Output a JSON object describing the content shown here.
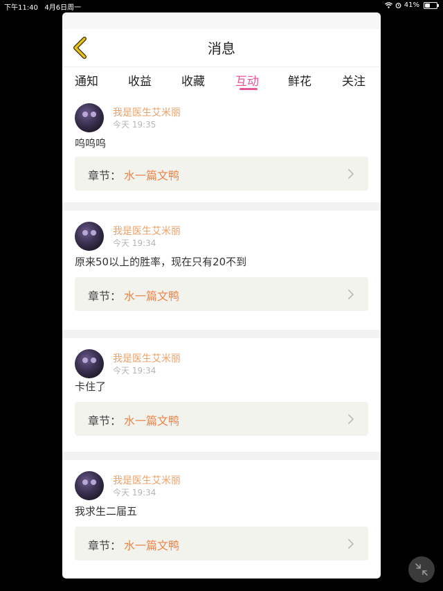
{
  "status_bar": {
    "time": "下午11:40",
    "date": "4月6日周一",
    "battery": "41%",
    "battery_level": 0.41
  },
  "header": {
    "title": "消息"
  },
  "tabs": [
    {
      "label": "通知",
      "active": false
    },
    {
      "label": "收益",
      "active": false
    },
    {
      "label": "收藏",
      "active": false
    },
    {
      "label": "互动",
      "active": true
    },
    {
      "label": "鲜花",
      "active": false
    },
    {
      "label": "关注",
      "active": false
    }
  ],
  "messages": [
    {
      "user": "我是医生艾米丽",
      "time": "今天 19:35",
      "text": "呜呜呜",
      "chapter_label": "章节：",
      "chapter_name": "水一篇文鸭"
    },
    {
      "user": "我是医生艾米丽",
      "time": "今天 19:34",
      "text": "原来50以上的胜率，现在只有20不到",
      "chapter_label": "章节：",
      "chapter_name": "水一篇文鸭"
    },
    {
      "user": "我是医生艾米丽",
      "time": "今天 19:34",
      "text": "卡住了",
      "chapter_label": "章节：",
      "chapter_name": "水一篇文鸭"
    },
    {
      "user": "我是医生艾米丽",
      "time": "今天 19:34",
      "text": "我求生二届五",
      "chapter_label": "章节：",
      "chapter_name": "水一篇文鸭"
    }
  ],
  "colors": {
    "accent_pink": "#e8569a",
    "username_orange": "#e8a06a",
    "chapter_orange": "#e8854a",
    "back_arrow": "#e6c21d"
  }
}
